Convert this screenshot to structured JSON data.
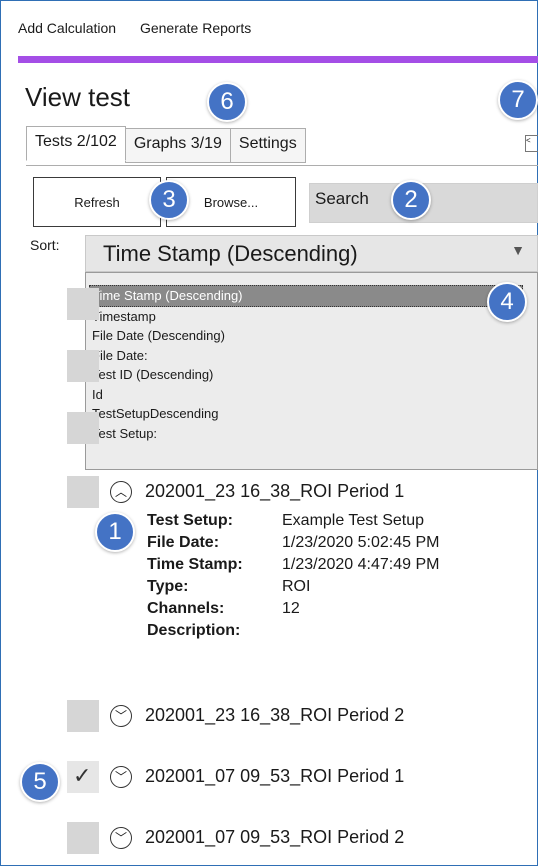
{
  "menu": {
    "add_calculation": "Add Calculation",
    "generate_reports": "Generate Reports"
  },
  "title": "View test",
  "tabs": [
    {
      "label": "Tests 2/102"
    },
    {
      "label": "Graphs 3/19"
    },
    {
      "label": "Settings"
    }
  ],
  "toolbar": {
    "refresh": "Refresh",
    "browse": "Browse...",
    "search_placeholder": "Search"
  },
  "sort": {
    "label": "Sort:",
    "value": "Time Stamp (Descending)",
    "arrow": "▼"
  },
  "sort_options": [
    "Time Stamp (Descending)",
    "Timestamp",
    "File Date (Descending)",
    "File Date:",
    "Test ID (Descending)",
    "Id",
    "TestSetupDescending",
    "Test Setup:"
  ],
  "tests": [
    {
      "name": "202001_23 16_38_ROI Period 1",
      "expanded": true,
      "checked": false
    },
    {
      "name": "202001_23 16_38_ROI Period 2",
      "expanded": false,
      "checked": false
    },
    {
      "name": "202001_07 09_53_ROI Period 1",
      "expanded": false,
      "checked": true
    },
    {
      "name": "202001_07 09_53_ROI Period 2",
      "expanded": false,
      "checked": false
    }
  ],
  "details": [
    {
      "k": "Test Setup:",
      "v": "Example Test Setup"
    },
    {
      "k": "File Date:",
      "v": "1/23/2020 5:02:45 PM"
    },
    {
      "k": "Time Stamp:",
      "v": "1/23/2020 4:47:49 PM"
    },
    {
      "k": "Type:",
      "v": "ROI"
    },
    {
      "k": "Channels:",
      "v": "12"
    },
    {
      "k": "Description:",
      "v": ""
    }
  ],
  "badges": [
    "1",
    "2",
    "3",
    "4",
    "5",
    "6",
    "7"
  ],
  "icons": {
    "expand": "chevron-up-icon",
    "collapse": "chevron-down-icon"
  },
  "colors": {
    "accent_bar": "#a44ee6",
    "badge": "#4473c5",
    "frame": "#2f6fb5"
  }
}
